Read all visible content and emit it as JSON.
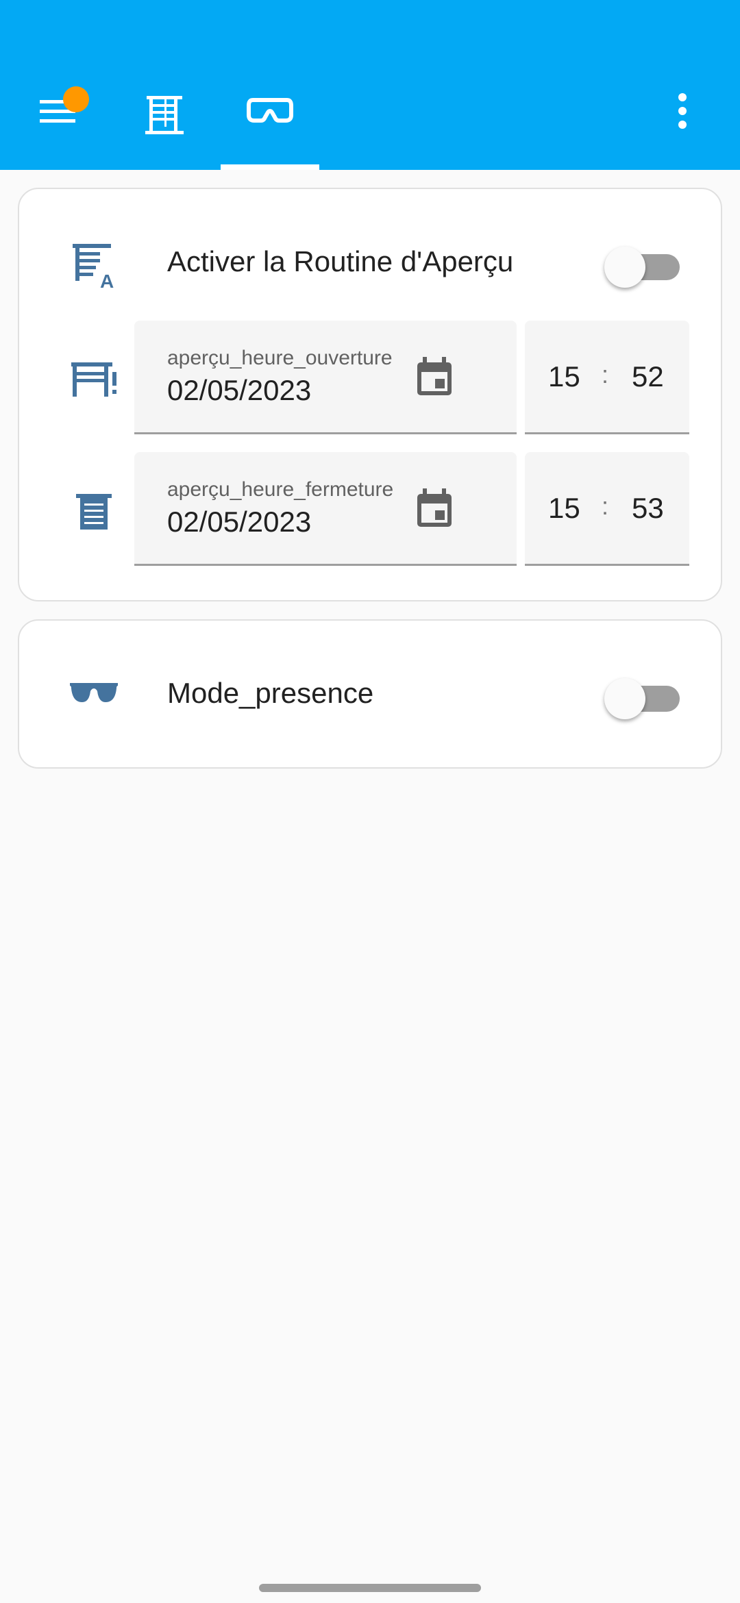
{
  "appbar": {
    "background_color": "#03a9f4",
    "menu_icon": "menu-icon",
    "notification_dot_color": "#ff9800",
    "tabs": [
      {
        "icon": "window-shutter-icon",
        "selected": false
      },
      {
        "icon": "goggles-icon",
        "selected": true
      }
    ],
    "overflow_icon": "dots-vertical-icon"
  },
  "cards": {
    "routine": {
      "toggle_row": {
        "icon": "window-shutter-auto-icon",
        "label": "Activer la Routine d'Aperçu",
        "checked": false
      },
      "open_row": {
        "icon": "window-shutter-alert-icon",
        "date_label": "aperçu_heure_ouverture",
        "date_value": "02/05/2023",
        "hour": "15",
        "separator": ":",
        "minute": "52"
      },
      "close_row": {
        "icon": "window-shutter-icon",
        "date_label": "aperçu_heure_fermeture",
        "date_value": "02/05/2023",
        "hour": "15",
        "separator": ":",
        "minute": "53"
      }
    },
    "presence": {
      "icon": "sunglasses-icon",
      "label": "Mode_presence",
      "checked": false
    }
  },
  "colors": {
    "icon_blue": "#44739e",
    "calendar_grey": "#616161",
    "toggle_off_track": "#9e9e9e"
  }
}
